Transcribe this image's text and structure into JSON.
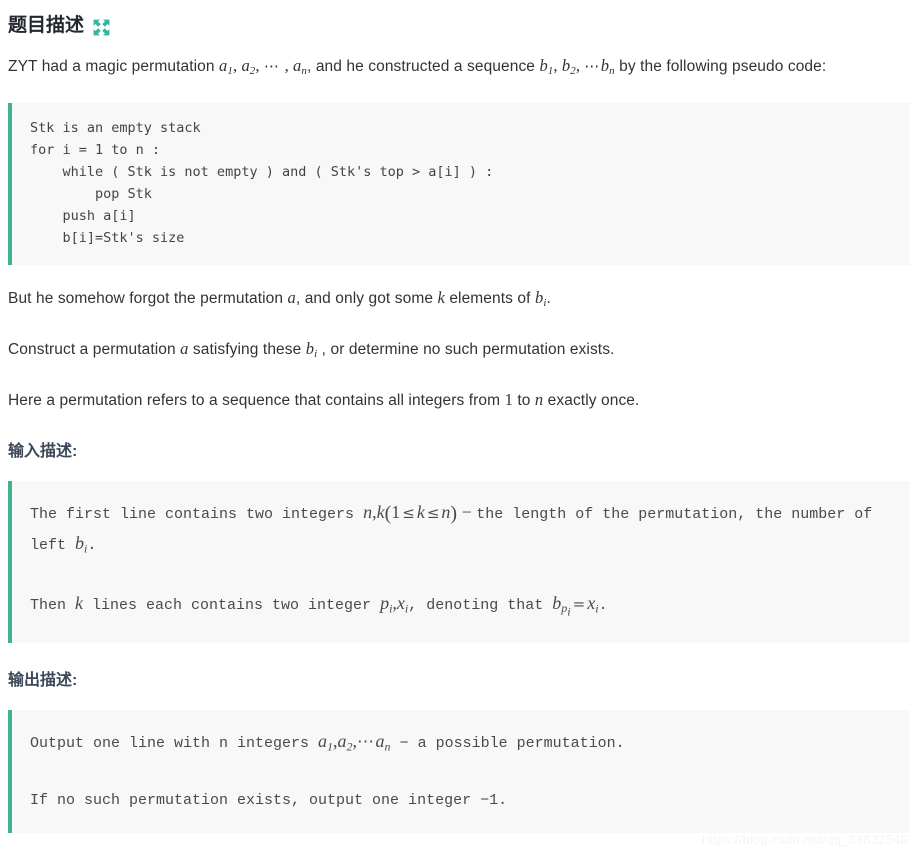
{
  "header": {
    "title": "题目描述",
    "expand_icon": "expand-arrows-icon",
    "accent_color": "#42b294"
  },
  "intro": {
    "line1_part1": "ZYT had a magic permutation ",
    "a1": "a",
    "a1_sub": "1",
    "a2": "a",
    "a2_sub": "2",
    "ellipsis": "⋯",
    "an": "a",
    "an_sub": "n",
    "line1_part2": ", and he constructed a sequence ",
    "b1": "b",
    "b1_sub": "1",
    "b2": "b",
    "b2_sub": "2",
    "bn": "b",
    "bn_sub": "n",
    "line1_part3": " by the following pseudo code:"
  },
  "pseudocode": "Stk is an empty stack\nfor i = 1 to n :\n    while ( Stk is not empty ) and ( Stk's top > a[i] ) :\n        pop Stk\n    push a[i]\n    b[i]=Stk's size",
  "para_forgot": {
    "part1": "But he somehow forgot the permutation ",
    "a": "a",
    "part2": ", and only got some ",
    "k": "k",
    "part3": " elements of ",
    "b": "b",
    "b_sub": "i",
    "part4": "."
  },
  "para_construct": {
    "part1": "Construct a permutation ",
    "a": "a",
    "part2": " satisfying these ",
    "b": "b",
    "b_sub": "i",
    "part3": " , or determine no such permutation exists."
  },
  "para_define": {
    "part1": "Here a permutation refers to a sequence that contains all integers from ",
    "one": "1",
    "part2": " to ",
    "n": "n",
    "part3": " exactly once."
  },
  "input_section": {
    "heading": "输入描述:",
    "line1_part1": "The first line contains two integers ",
    "n": "n",
    "comma": ",",
    "k": "k",
    "open_paren": "(",
    "one": "1",
    "le1": "≤",
    "k2": "k",
    "le2": "≤",
    "n2": "n",
    "close_paren": ")",
    "dash": " − ",
    "line1_part2": "the length of the permutation, the number of  left ",
    "b": "b",
    "b_sub": "i",
    "period": ".",
    "line2_part1": "Then ",
    "k3": "k",
    "line2_part2": " lines each contains two integer ",
    "p": "p",
    "p_sub": "i",
    "x": "x",
    "x_sub": "i",
    "line2_part3": ", denoting that ",
    "bp": "b",
    "bp_sub": "p",
    "bp_sub2": "i",
    "eq": "=",
    "x2": "x",
    "x2_sub": "i",
    "period2": "."
  },
  "output_section": {
    "heading": "输出描述:",
    "line1_part1": "Output one line with n integers ",
    "a1": "a",
    "a1_sub": "1",
    "a2": "a",
    "a2_sub": "2",
    "ellipsis": "⋯",
    "an": "a",
    "an_sub": "n",
    "dash": " − ",
    "line1_part2": "a possible permutation.",
    "line2": "If no such permutation exists, output one integer −1."
  },
  "watermark": "https://blog.csdn.net/qq_34832548"
}
